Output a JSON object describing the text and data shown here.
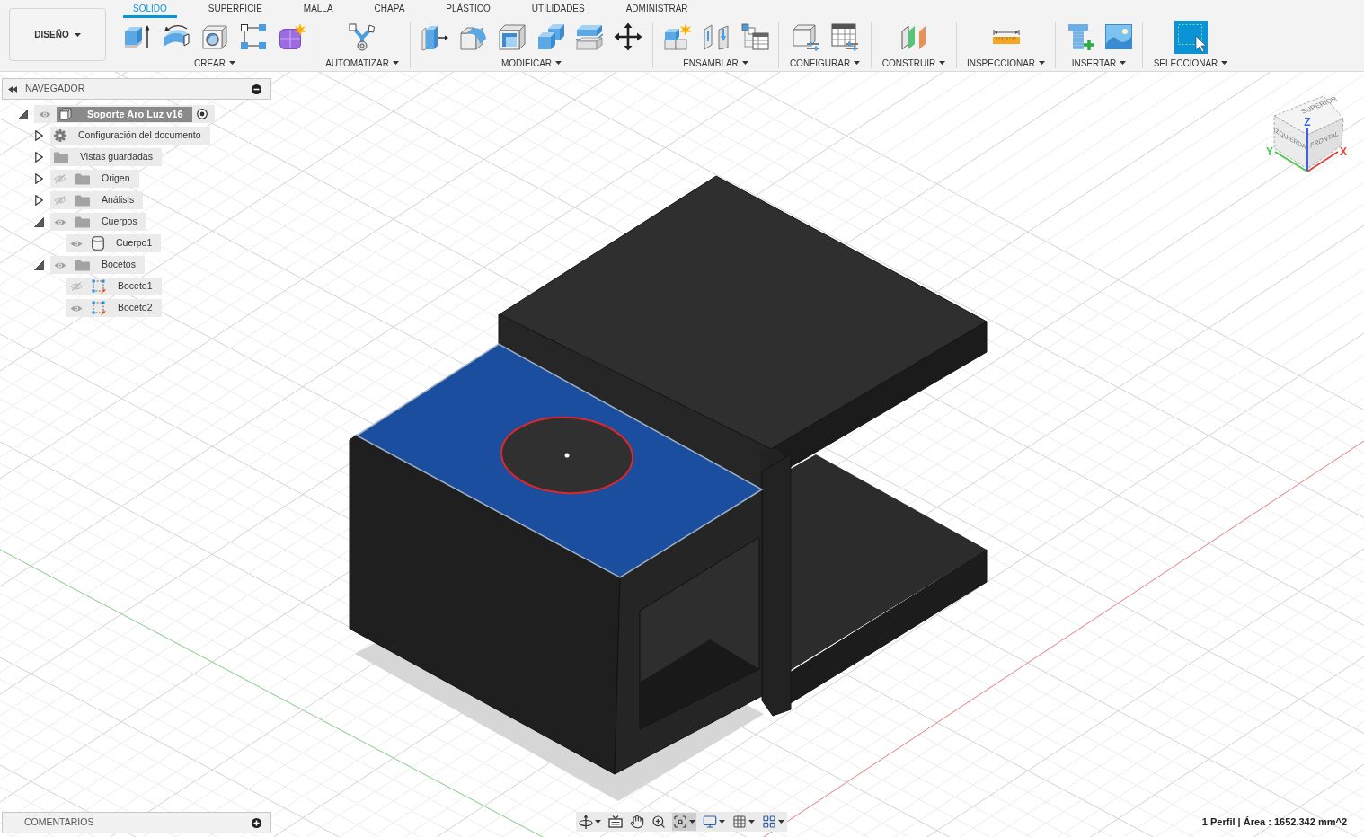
{
  "toolbar": {
    "workspace": "DISEÑO",
    "tabs": [
      {
        "label": "SOLIDO",
        "selected": true
      },
      {
        "label": "SUPERFICIE",
        "selected": false
      },
      {
        "label": "MALLA",
        "selected": false
      },
      {
        "label": "CHAPA",
        "selected": false
      },
      {
        "label": "PLÁSTICO",
        "selected": false
      },
      {
        "label": "UTILIDADES",
        "selected": false
      },
      {
        "label": "ADMINISTRAR",
        "selected": false
      }
    ],
    "groups": [
      {
        "label": "CREAR",
        "kind": "create"
      },
      {
        "label": "AUTOMATIZAR",
        "kind": "automate"
      },
      {
        "label": "MODIFICAR",
        "kind": "modify"
      },
      {
        "label": "ENSAMBLAR",
        "kind": "assemble"
      },
      {
        "label": "CONFIGURAR",
        "kind": "configure"
      },
      {
        "label": "CONSTRUIR",
        "kind": "construct"
      },
      {
        "label": "INSPECCIONAR",
        "kind": "inspect"
      },
      {
        "label": "INSERTAR",
        "kind": "insert"
      },
      {
        "label": "SELECCIONAR",
        "kind": "select"
      }
    ]
  },
  "navigator": {
    "title": "NAVEGADOR",
    "tree": [
      {
        "label": "Soporte Aro Luz v16",
        "kind": "component",
        "expanded": true,
        "visible": true,
        "active": true,
        "children": [
          {
            "label": "Configuración del documento",
            "kind": "settings",
            "expanded": false
          },
          {
            "label": "Vistas guardadas",
            "kind": "folder",
            "expanded": false
          },
          {
            "label": "Origen",
            "kind": "folder",
            "expanded": false,
            "visible": false
          },
          {
            "label": "Análisis",
            "kind": "folder",
            "expanded": false,
            "visible": false
          },
          {
            "label": "Cuerpos",
            "kind": "folder",
            "expanded": true,
            "visible": true,
            "children": [
              {
                "label": "Cuerpo1",
                "kind": "body",
                "visible": true
              }
            ]
          },
          {
            "label": "Bocetos",
            "kind": "folder",
            "expanded": true,
            "visible": true,
            "children": [
              {
                "label": "Boceto1",
                "kind": "sketch",
                "visible": false
              },
              {
                "label": "Boceto2",
                "kind": "sketch",
                "visible": true
              }
            ]
          }
        ]
      }
    ]
  },
  "viewport": {
    "model": {
      "face_selected": true
    },
    "view_cube": {
      "faces": [
        "SUPERIOR",
        "IZQUIERDA",
        "FRONTAL"
      ],
      "axes": [
        {
          "label": "Z",
          "color": "#3d5fe0"
        },
        {
          "label": "X",
          "color": "#e8403a"
        },
        {
          "label": "Y",
          "color": "#4cc44c"
        }
      ]
    }
  },
  "comments": {
    "title": "COMENTARIOS"
  },
  "nav_bar": {
    "tools": [
      {
        "kind": "orbit",
        "dropdown": true,
        "selected": false
      },
      {
        "kind": "look_at",
        "dropdown": false,
        "selected": false
      },
      {
        "kind": "pan",
        "dropdown": false,
        "selected": false
      },
      {
        "kind": "zoom",
        "dropdown": false,
        "selected": false
      },
      {
        "kind": "fit",
        "dropdown": true,
        "selected": true
      },
      {
        "kind": "display",
        "dropdown": true,
        "selected": false
      },
      {
        "kind": "grid",
        "dropdown": true,
        "selected": false
      },
      {
        "kind": "viewports",
        "dropdown": true,
        "selected": false
      }
    ]
  },
  "status_bar": {
    "text": "1 Perfil | Área : 1652.342 mm^2"
  }
}
